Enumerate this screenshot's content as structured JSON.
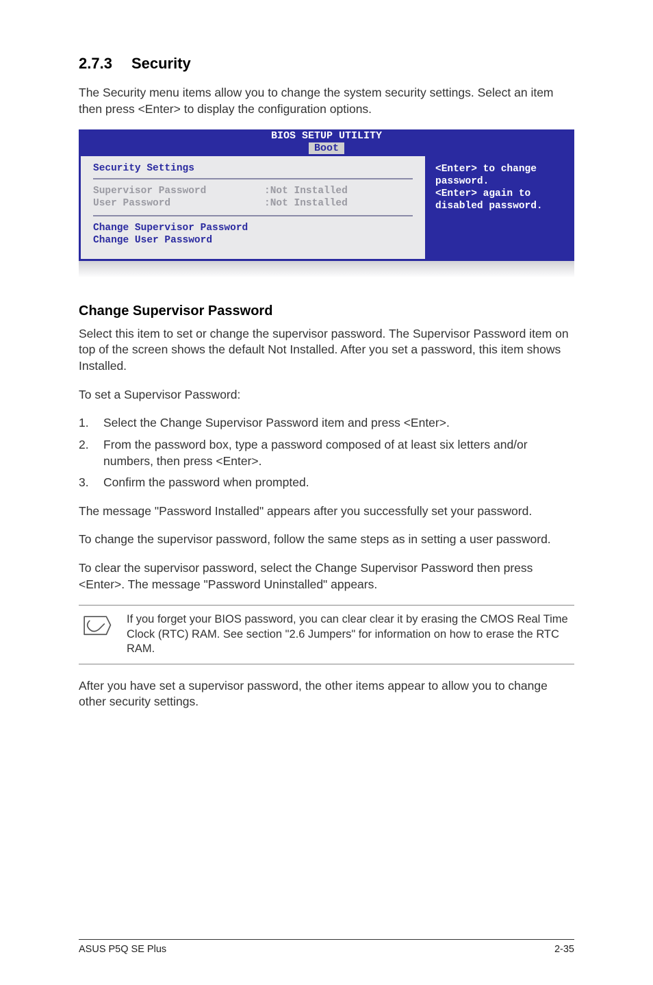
{
  "section": {
    "number": "2.7.3",
    "title": "Security"
  },
  "intro": "The Security menu items allow you to change the system security settings. Select an item then press <Enter> to display the configuration options.",
  "bios": {
    "title": "BIOS SETUP UTILITY",
    "tab": "Boot",
    "panel_title": "Security Settings",
    "status": [
      {
        "label": "Supervisor Password",
        "value": ":Not Installed"
      },
      {
        "label": "User Password",
        "value": ":Not Installed"
      }
    ],
    "actions": [
      "Change Supervisor Password",
      "Change User Password"
    ],
    "help": [
      "<Enter> to change",
      "password.",
      "<Enter> again to",
      "disabled password."
    ]
  },
  "sub": {
    "heading": "Change Supervisor Password",
    "p1": "Select this item to set or change the supervisor password. The Supervisor Password item on top of the screen shows the default Not Installed. After you set a password, this item shows Installed.",
    "p2": "To set a Supervisor Password:",
    "steps": [
      "Select the Change Supervisor Password item and press <Enter>.",
      "From the password box, type a password composed of at least six letters and/or numbers, then press <Enter>.",
      "Confirm the password when prompted."
    ],
    "p3": "The message \"Password Installed\" appears after you successfully set your password.",
    "p4": "To change the supervisor password, follow the same steps as in setting a user password.",
    "p5": "To clear the supervisor password, select the Change Supervisor Password then press <Enter>. The message \"Password Uninstalled\" appears."
  },
  "note": "If you forget your BIOS password, you can clear clear it by erasing the CMOS Real Time Clock (RTC) RAM. See section \"2.6 Jumpers\" for information on how to erase the RTC RAM.",
  "after_note": "After you have set a supervisor password, the other items appear to allow you to change other security settings.",
  "footer": {
    "left": "ASUS P5Q SE Plus",
    "right": "2-35"
  }
}
